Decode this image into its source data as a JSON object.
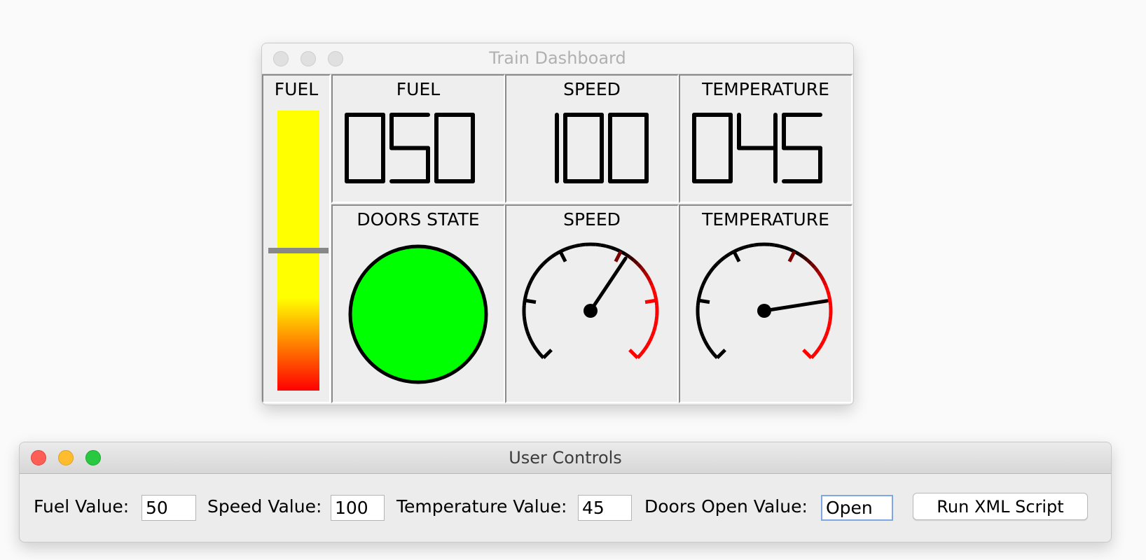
{
  "dashboard_window": {
    "title": "Train Dashboard",
    "fuel_bar": {
      "label": "FUEL",
      "level_percent": 50
    },
    "digital_displays": [
      {
        "label": "FUEL",
        "digits": "050"
      },
      {
        "label": "SPEED",
        "digits": "100"
      },
      {
        "label": "TEMPERATURE",
        "digits": "045"
      }
    ],
    "doors_state": {
      "label": "DOORS STATE",
      "status": "open",
      "color": "#00ff00"
    },
    "gauges": [
      {
        "label": "SPEED",
        "value_fraction": 0.625
      },
      {
        "label": "TEMPERATURE",
        "value_fraction": 0.8
      }
    ]
  },
  "controls_window": {
    "title": "User Controls",
    "fuel_label": "Fuel Value:",
    "fuel_value": "50",
    "speed_label": "Speed Value:",
    "speed_value": "100",
    "temperature_label": "Temperature Value:",
    "temperature_value": "45",
    "doors_label": "Doors Open Value:",
    "doors_value": "Open",
    "run_button": "Run XML Script"
  },
  "colors": {
    "fuel_high": "#ffff00",
    "fuel_low": "#ff0000",
    "gauge_danger": "#ff0000",
    "digit_color": "#000000"
  },
  "icons": {
    "window_close": "close-icon",
    "window_minimize": "minimize-icon",
    "window_zoom": "zoom-icon"
  }
}
